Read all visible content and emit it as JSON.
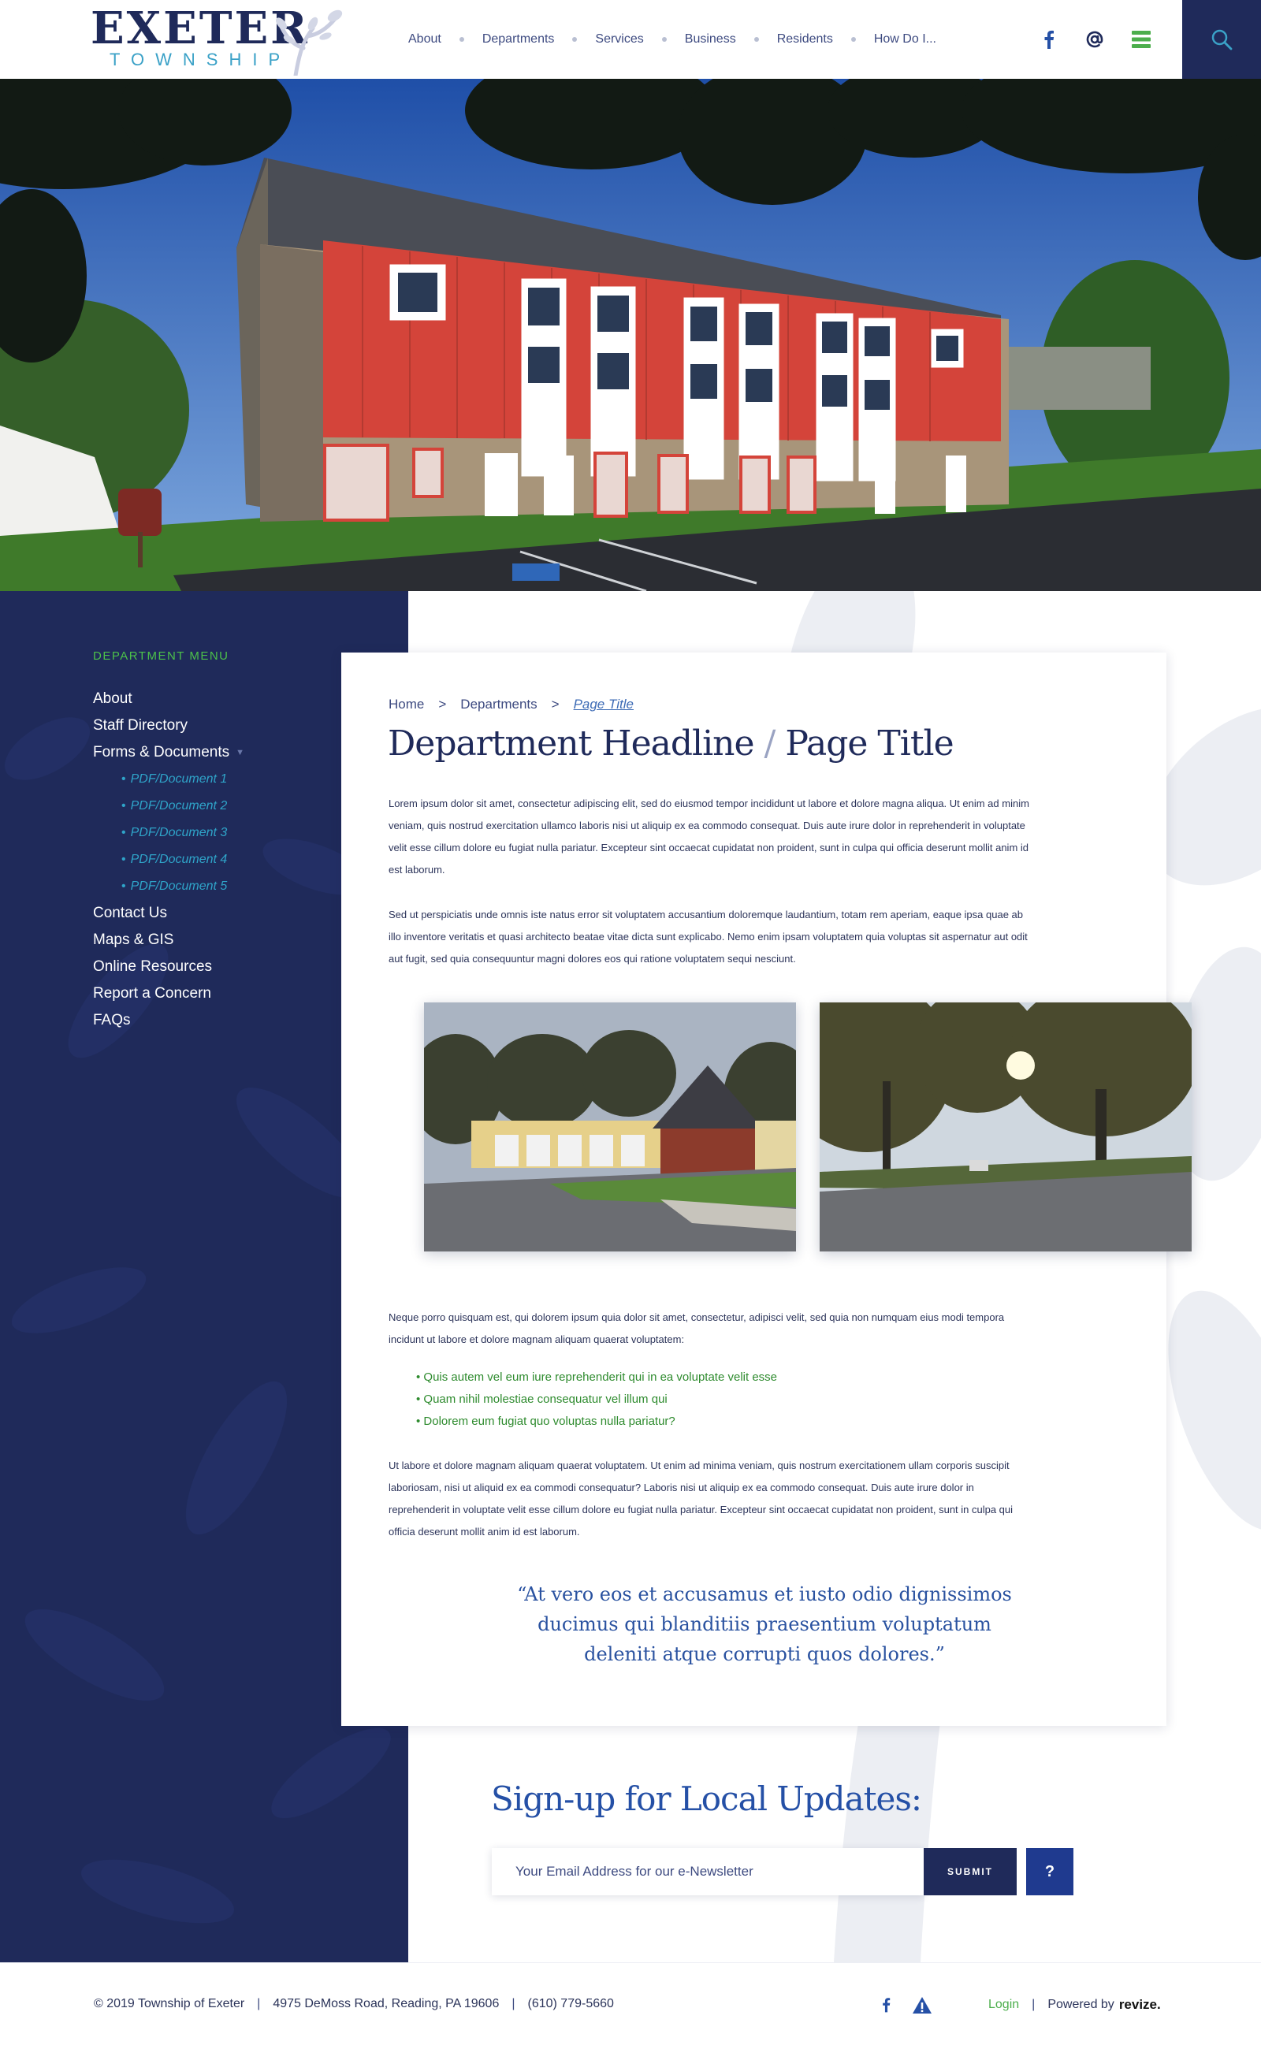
{
  "brand": {
    "name": "EXETER",
    "sub": "TOWNSHIP",
    "colors": {
      "navy": "#1f2a5a",
      "green": "#4cc14a",
      "teal": "#3aa1c7",
      "blue": "#2550a6"
    }
  },
  "nav": {
    "items": [
      "About",
      "Departments",
      "Services",
      "Business",
      "Residents",
      "How Do I..."
    ]
  },
  "header_icons": {
    "facebook": "facebook-icon",
    "email": "at-sign-icon",
    "menu": "hamburger-menu-icon",
    "search": "search-icon"
  },
  "sidebar": {
    "title": "DEPARTMENT MENU",
    "items": [
      "About",
      "Staff Directory",
      "Forms & Documents"
    ],
    "subitems": [
      "PDF/Document 1",
      "PDF/Document 2",
      "PDF/Document 3",
      "PDF/Document 4",
      "PDF/Document 5"
    ],
    "items_after": [
      "Contact Us",
      "Maps & GIS",
      "Online Resources",
      "Report a Concern",
      "FAQs"
    ]
  },
  "breadcrumb": {
    "home": "Home",
    "sep": ">",
    "section": "Departments",
    "current": "Page Title"
  },
  "page": {
    "title_main": "Department Headline",
    "title_slash": "/",
    "title_end": "Page Title",
    "p1": "Lorem ipsum dolor sit amet, consectetur adipiscing elit, sed do eiusmod tempor incididunt ut labore et dolore magna aliqua. Ut enim ad minim veniam, quis nostrud exercitation ullamco laboris nisi ut aliquip ex ea commodo consequat. Duis aute irure dolor in reprehenderit in voluptate velit esse cillum dolore eu fugiat nulla pariatur. Excepteur sint occaecat cupidatat non proident, sunt in culpa qui officia deserunt mollit anim id est laborum.",
    "p2": "Sed ut perspiciatis unde omnis iste natus error sit voluptatem accusantium doloremque laudantium, totam rem aperiam, eaque ipsa quae ab illo inventore veritatis et quasi architecto beatae vitae dicta sunt explicabo. Nemo enim ipsam voluptatem quia voluptas sit aspernatur aut odit aut fugit, sed quia consequuntur magni dolores eos qui ratione voluptatem sequi nesciunt.",
    "p3": "Neque porro quisquam est, qui dolorem ipsum quia dolor sit amet, consectetur, adipisci velit, sed quia non numquam eius modi tempora incidunt ut labore et dolore magnam aliquam quaerat voluptatem:",
    "bullets": [
      "Quis autem vel eum iure reprehenderit qui in ea voluptate velit esse",
      "Quam nihil molestiae consequatur vel illum qui",
      "Dolorem eum fugiat quo voluptas nulla pariatur?"
    ],
    "p4": "Ut labore et dolore magnam aliquam quaerat voluptatem. Ut enim ad minima veniam, quis nostrum exercitationem ullam corporis suscipit laboriosam, nisi ut aliquid ex ea commodi consequatur? Laboris nisi ut aliquip ex ea commodo consequat. Duis aute irure dolor in reprehenderit in voluptate velit esse cillum dolore eu fugiat nulla pariatur. Excepteur sint occaecat cupidatat non proident, sunt in culpa qui officia deserunt mollit anim id est laborum.",
    "quote": "“At vero eos et accusamus et iusto odio dignissimos ducimus qui blanditiis praesentium voluptatum deleniti atque corrupti quos dolores.”"
  },
  "signup": {
    "title": "Sign-up for Local Updates:",
    "placeholder": "Your Email Address for our e-Newsletter",
    "submit": "SUBMIT",
    "help": "?"
  },
  "footer": {
    "copyright": "© 2019 Township of Exeter",
    "address": "4975 DeMoss Road, Reading, PA 19606",
    "phone": "(610) 779-5660",
    "sep": "|",
    "login": "Login",
    "powered": "Powered by",
    "revize": "revize."
  }
}
